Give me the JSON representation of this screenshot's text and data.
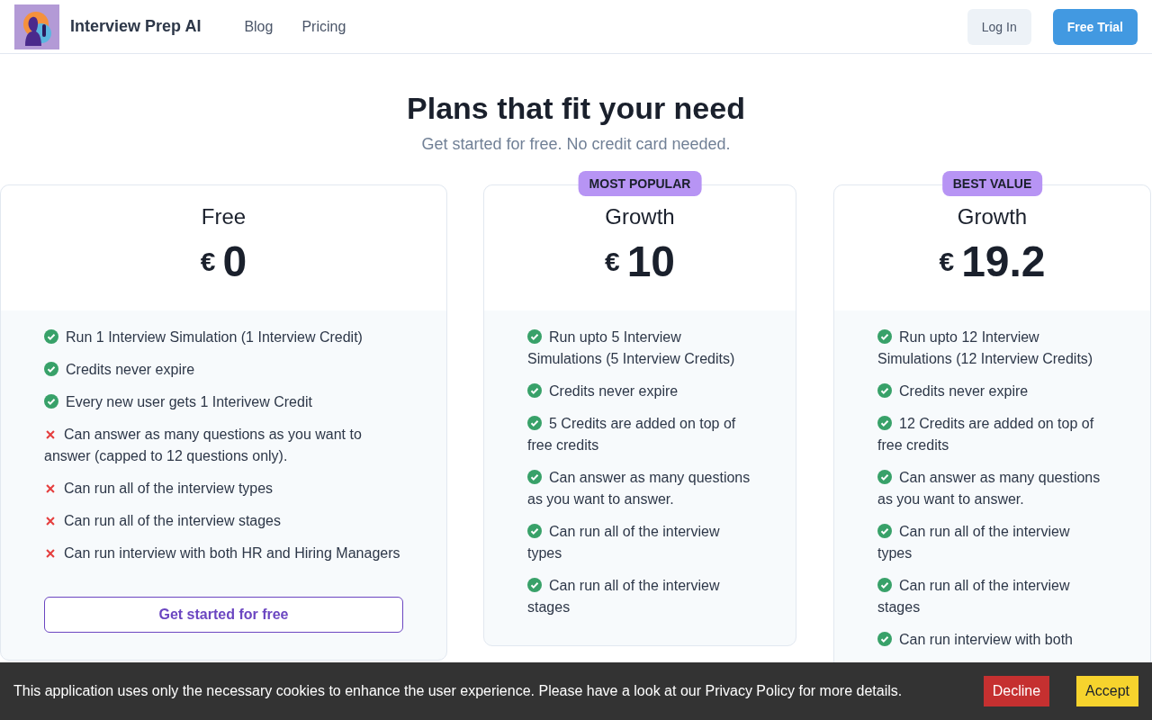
{
  "brand": {
    "name": "Interview Prep AI"
  },
  "nav": [
    {
      "label": "Blog"
    },
    {
      "label": "Pricing"
    }
  ],
  "actions": {
    "login": "Log In",
    "trial": "Free Trial"
  },
  "hero": {
    "title": "Plans that fit your need",
    "subtitle": "Get started for free. No credit card needed."
  },
  "plans": [
    {
      "name": "Free",
      "currency": "€",
      "price": "0",
      "features": [
        {
          "text": "Run 1 Interview Simulation (1 Interview Credit)",
          "included": true
        },
        {
          "text": "Credits never expire",
          "included": true
        },
        {
          "text": "Every new user gets 1 Interivew Credit",
          "included": true
        },
        {
          "text": "Can answer as many questions as you want to answer (capped to 12 questions only).",
          "included": false
        },
        {
          "text": "Can run all of the interview types",
          "included": false
        },
        {
          "text": "Can run all of the interview stages",
          "included": false
        },
        {
          "text": "Can run interview with both HR and Hiring Managers",
          "included": false
        }
      ],
      "button": "Get started for free"
    },
    {
      "name": "Growth",
      "badge": "MOST POPULAR",
      "currency": "€",
      "price": "10",
      "features": [
        {
          "text": "Run upto 5 Interview Simulations (5 Interview Credits)",
          "included": true
        },
        {
          "text": "Credits never expire",
          "included": true
        },
        {
          "text": "5 Credits are added on top of free credits",
          "included": true
        },
        {
          "text": "Can answer as many questions as you want to answer.",
          "included": true
        },
        {
          "text": "Can run all of the interview types",
          "included": true
        },
        {
          "text": "Can run all of the interview stages",
          "included": true
        }
      ]
    },
    {
      "name": "Growth",
      "badge": "BEST VALUE",
      "currency": "€",
      "price": "19.2",
      "features": [
        {
          "text": "Run upto 12 Interview Simulations (12 Interview Credits)",
          "included": true
        },
        {
          "text": "Credits never expire",
          "included": true
        },
        {
          "text": "12 Credits are added on top of free credits",
          "included": true
        },
        {
          "text": "Can answer as many questions as you want to answer.",
          "included": true
        },
        {
          "text": "Can run all of the interview types",
          "included": true
        },
        {
          "text": "Can run all of the interview stages",
          "included": true
        },
        {
          "text": "Can run interview with both",
          "included": true
        }
      ]
    }
  ],
  "cookie": {
    "message": "This application uses only the necessary cookies to enhance the user experience. Please have a look at our Privacy Policy for more details.",
    "decline": "Decline",
    "accept": "Accept"
  }
}
